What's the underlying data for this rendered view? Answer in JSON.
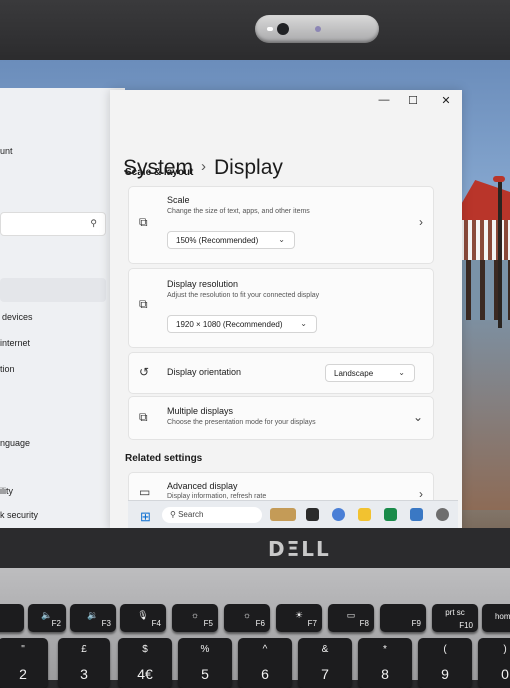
{
  "background_window": {
    "items": [
      "unt",
      "devices",
      "internet",
      "tion",
      "nguage",
      "ility",
      "k security"
    ]
  },
  "window_controls": {
    "minimize": "—",
    "maximize": "☐",
    "close": "✕"
  },
  "breadcrumb": {
    "parent": "System",
    "separator": "›",
    "current": "Display"
  },
  "scale_layout": {
    "heading": "Scale & layout",
    "scale": {
      "title": "Scale",
      "subtitle": "Change the size of text, apps, and other items",
      "value": "150% (Recommended)"
    },
    "resolution": {
      "title": "Display resolution",
      "subtitle": "Adjust the resolution to fit your connected display",
      "value": "1920 × 1080 (Recommended)"
    },
    "orientation": {
      "title": "Display orientation",
      "value": "Landscape"
    },
    "multiple": {
      "title": "Multiple displays",
      "subtitle": "Choose the presentation mode for your displays"
    }
  },
  "related": {
    "heading": "Related settings",
    "advanced": {
      "title": "Advanced display",
      "subtitle": "Display information, refresh rate"
    }
  },
  "taskbar": {
    "search_placeholder": "Search"
  },
  "laptop_logo": "DΞLL",
  "keys": {
    "f2": "F2",
    "f3": "F3",
    "f4": "F4",
    "f5": "F5",
    "f6": "F6",
    "f7": "F7",
    "f8": "F8",
    "f9": "F9",
    "prtsc": "prt sc",
    "f10": "F10",
    "home": "home",
    "num2": "2",
    "num3": "3",
    "num4": "4€",
    "num5": "5",
    "num6": "6",
    "num7": "7",
    "num8": "8",
    "num9": "9",
    "num0": "0",
    "sym2": "\"",
    "sym3": "£",
    "sym4": "$",
    "sym5": "%",
    "sym6": "^",
    "sym7": "&",
    "sym8": "*",
    "sym9": "(",
    "sym0": ")"
  },
  "colors": {
    "accent": "#0a6ed1",
    "window_bg": "#f3f3f3"
  }
}
